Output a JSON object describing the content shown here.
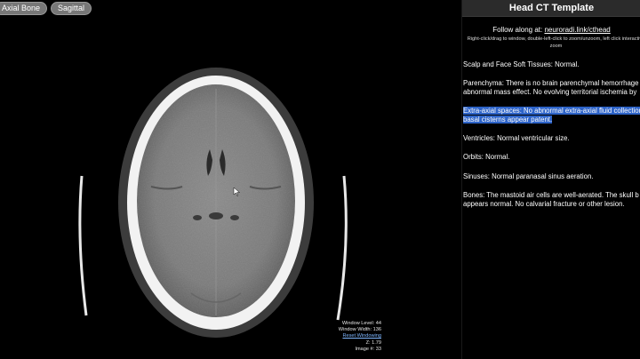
{
  "tabs": [
    {
      "label": "Axial Bone"
    },
    {
      "label": "Sagittal"
    }
  ],
  "viewer": {
    "window_level": "Window Level: 44",
    "window_width": "Window Width: 136",
    "reset_windowing": "Reset Windowing",
    "z": "Z: 1.79",
    "image_number": "Image #: 33"
  },
  "panel": {
    "title": "Head CT Template",
    "follow_prefix": "Follow along at: ",
    "follow_link": "neuroradi.link/cthead",
    "hint": "Right-click/drag to window, double-left-click to zoom/unzoom, left click interactive zoom",
    "sections": [
      {
        "text": "Scalp and Face Soft Tissues: Normal."
      },
      {
        "text": "Parenchyma: There is no brain parenchymal hemorrhage abnormal mass effect. No evolving territorial ischemia by"
      },
      {
        "text": "Extra-axial spaces: No abnormal extra-axial fluid collection basal cisterns appear patent."
      },
      {
        "text": "Ventricles: Normal ventricular size."
      },
      {
        "text": "Orbits: Normal."
      },
      {
        "text": "Sinuses: Normal paranasal sinus aeration."
      },
      {
        "text": "Bones: The mastoid air cells are well-aerated. The skull b appears normal. No calvarial fracture or other lesion."
      }
    ]
  },
  "colors": {
    "highlight": "#2d63c8",
    "panel_title_bg": "#2b2b2b",
    "tab_bg": "#777777"
  }
}
